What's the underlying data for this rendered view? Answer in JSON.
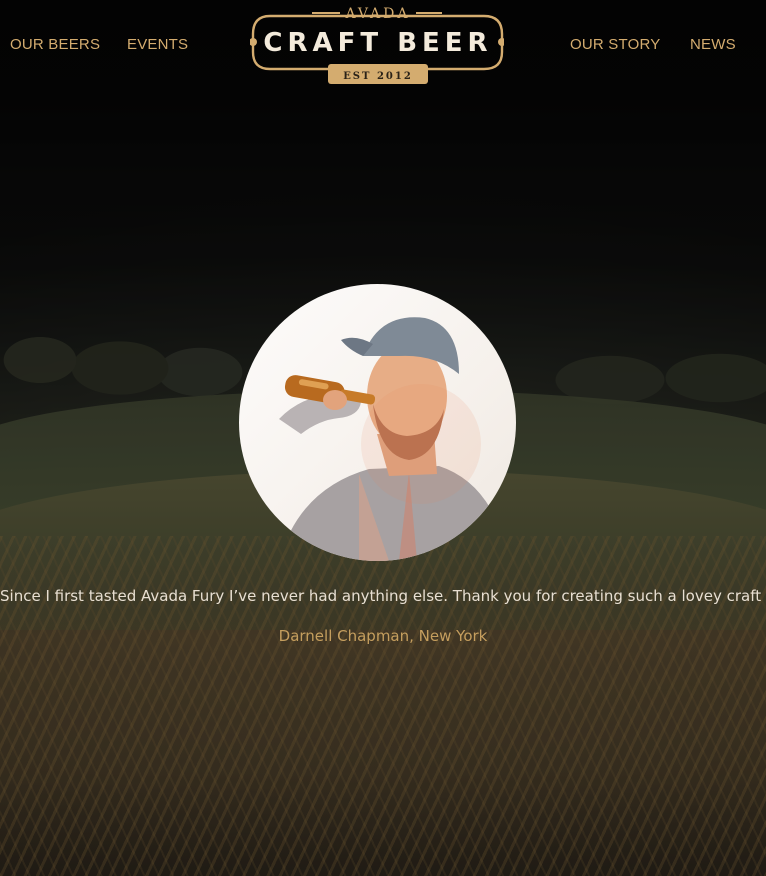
{
  "nav": {
    "left": [
      {
        "label": "OUR BEERS"
      },
      {
        "label": "EVENTS"
      }
    ],
    "right": [
      {
        "label": "OUR STORY"
      },
      {
        "label": "NEWS"
      }
    ]
  },
  "logo": {
    "top_text": "AVADA",
    "main_text": "CRAFT BEER",
    "badge_text": "EST 2012"
  },
  "testimonial": {
    "avatar_icon": "person-drinking-beer-photo",
    "quote": "Since I first tasted Avada Fury I’ve never had anything else. Thank you for creating such a lovey craft beer",
    "author": "Darnell Chapman, New York"
  },
  "colors": {
    "accent": "#d4ac6f",
    "author": "#c59e5e",
    "quote_text": "#e8dfd2"
  }
}
